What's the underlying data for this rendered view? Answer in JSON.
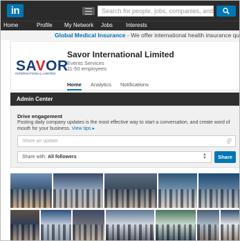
{
  "topbar": {
    "logo_text": "in",
    "search_placeholder": "Search for people, jobs, companies, and more..."
  },
  "nav": {
    "items": [
      "Home",
      "Profile",
      "My Network",
      "Jobs",
      "Interests"
    ]
  },
  "ad": {
    "link_text": "Global Medical Insurance",
    "text": " - We offer international health insurance quotes for"
  },
  "company": {
    "logo_word": [
      "SA",
      "V",
      "OR"
    ],
    "logo_tagline": "INTERNATIONAL LIMITED",
    "name": "Savor International Limited",
    "industry": "Events Services",
    "size": "11-50 employees",
    "tabs": [
      "Home",
      "Analytics",
      "Notifications"
    ],
    "active_tab": "Home"
  },
  "admin": {
    "header": "Admin Center",
    "drive_title": "Drive engagement",
    "drive_text": "Posting daily company updates is the most effective way to start a conversation, and create word of mouth for your business.",
    "view_tips": "View tips",
    "update_placeholder": "Share an update",
    "share_with_label": "Share with:",
    "share_with_value": "All followers",
    "share_button": "Share"
  },
  "photos": [
    {
      "name": "exhibition-hall",
      "colors": [
        "#6d8fb5",
        "#3f5a79",
        "#c9a37a"
      ]
    },
    {
      "name": "booth-crowd",
      "colors": [
        "#3a4c6b",
        "#8c9fb9",
        "#c1b6a4"
      ]
    },
    {
      "name": "conference-floor",
      "colors": [
        "#5a6c81",
        "#3e4d60",
        "#b7a895"
      ]
    },
    {
      "name": "booth-visitors",
      "colors": [
        "#2d5777",
        "#6f8fab",
        "#d6ccc0"
      ]
    },
    {
      "name": "expo-stand",
      "colors": [
        "#1c4a74",
        "#5d7b98",
        "#c7c2bb"
      ]
    },
    {
      "name": "meeting-lounge",
      "colors": [
        "#5f4e44",
        "#2f3f55",
        "#a48f7c"
      ]
    },
    {
      "name": "booth-banner",
      "colors": [
        "#284f7d",
        "#bfc9d6",
        "#7f8d9c"
      ]
    },
    {
      "name": "visitors-corner",
      "colors": [
        "#3a4963",
        "#6f6f7a",
        "#b8a994"
      ]
    },
    {
      "name": "aisle-crowd",
      "colors": [
        "#5b7896",
        "#d0d6de",
        "#4a4d57"
      ]
    },
    {
      "name": "stand-green",
      "colors": [
        "#47745a",
        "#c9d8cf",
        "#30424f"
      ]
    },
    {
      "name": "event-hall",
      "colors": [
        "#485b71",
        "#a7b7c5",
        "#6c5f57"
      ]
    },
    {
      "name": "booth-display",
      "colors": [
        "#2c4a6c",
        "#e2e4e8",
        "#8b7a6d"
      ]
    }
  ]
}
